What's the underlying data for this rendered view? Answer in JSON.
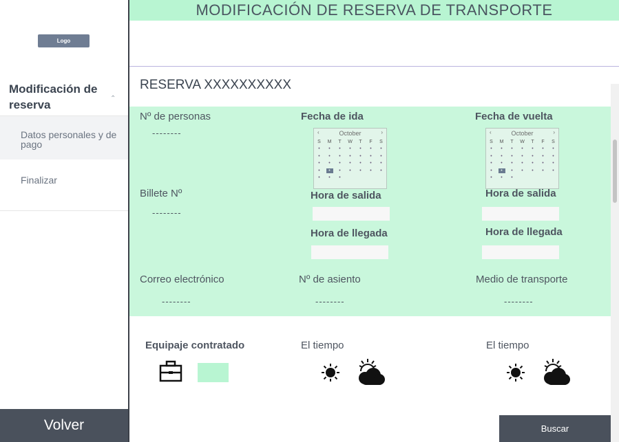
{
  "sidebar": {
    "logo": "Logo",
    "menu_title": "Modificación de reserva",
    "items": [
      {
        "label": "Datos personales y de pago"
      },
      {
        "label": "Finalizar"
      }
    ],
    "back_label": "Volver"
  },
  "header": {
    "title": "MODIFICACIÓN DE RESERVA DE TRANSPORTE"
  },
  "reservation": {
    "title": "RESERVA XXXXXXXXXX",
    "persons_label": "Nº de personas",
    "persons_value": "--------",
    "ticket_label": "Billete Nº",
    "ticket_value": "--------",
    "email_label": "Correo electrónico",
    "email_value": "--------",
    "seat_label": "Nº de asiento",
    "seat_value": "--------",
    "transport_label": "Medio de transporte",
    "transport_value": "--------",
    "outbound": {
      "date_label": "Fecha de ida",
      "departure_label": "Hora de salida",
      "arrival_label": "Hora de llegada",
      "calendar_month": "October"
    },
    "return": {
      "date_label": "Fecha de vuelta",
      "departure_label": "Hora de salida",
      "arrival_label": "Hora de llegada",
      "calendar_month": "October"
    }
  },
  "calendar_weekdays": [
    "S",
    "M",
    "T",
    "W",
    "T",
    "F",
    "S"
  ],
  "lower": {
    "luggage_label": "Equipaje contratado",
    "weather_label_1": "El tiempo",
    "weather_label_2": "El tiempo"
  },
  "actions": {
    "search_label": "Buscar"
  },
  "colors": {
    "accent_green": "#b8f5d2",
    "panel_green": "#c9f7dc",
    "dark_button": "#4a515c"
  }
}
